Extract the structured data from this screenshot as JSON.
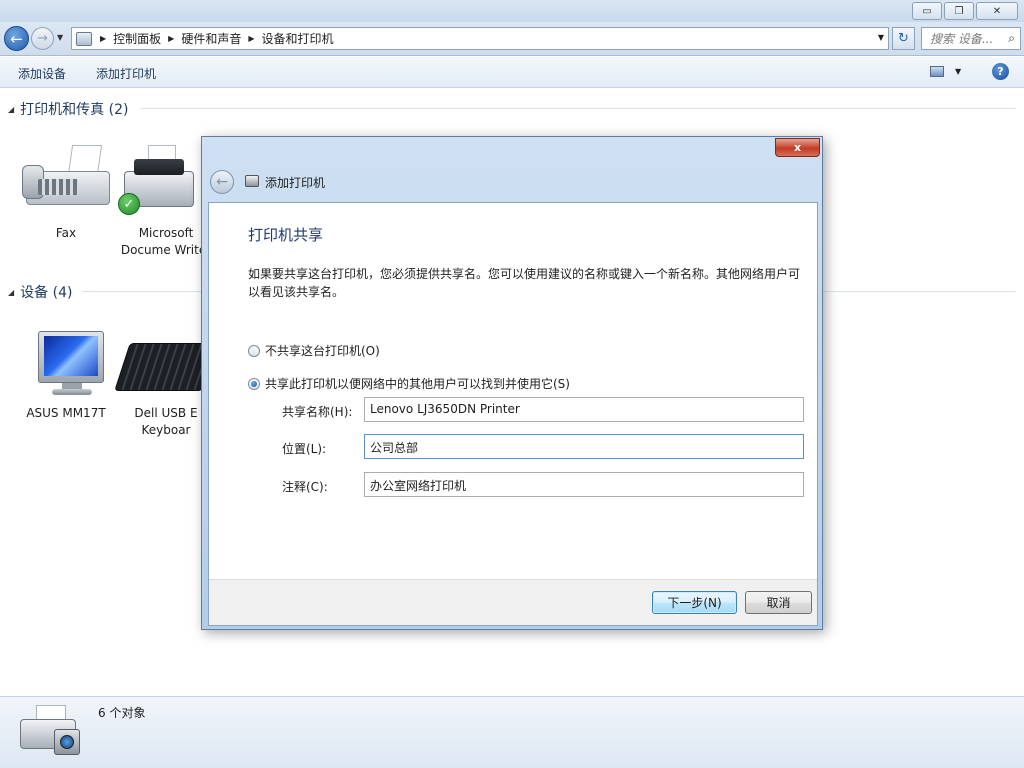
{
  "window": {
    "min_glyph": "▭",
    "max_glyph": "❐",
    "close_glyph": "✕"
  },
  "nav": {
    "back_glyph": "←",
    "fwd_glyph": "→",
    "breadcrumb": [
      "控制面板",
      "硬件和声音",
      "设备和打印机"
    ],
    "search_placeholder": "搜索 设备...",
    "refresh_glyph": "↻",
    "search_glyph": "⌕"
  },
  "toolbar": {
    "add_device": "添加设备",
    "add_printer": "添加打印机",
    "help_glyph": "?"
  },
  "groups": {
    "printers": {
      "title": "打印机和传真 (2)",
      "items": [
        {
          "label": "Fax"
        },
        {
          "label": "Microsoft Docume Writer"
        }
      ]
    },
    "devices": {
      "title": "设备 (4)",
      "items": [
        {
          "label": "ASUS MM17T"
        },
        {
          "label": "Dell USB E Keyboar"
        }
      ]
    }
  },
  "status": {
    "count": "6 个对象"
  },
  "dialog": {
    "window_title": "添加打印机",
    "close_glyph": "x",
    "back_glyph": "←",
    "heading": "打印机共享",
    "description": "如果要共享这台打印机，您必须提供共享名。您可以使用建议的名称或键入一个新名称。其他网络用户可以看见该共享名。",
    "option_no_share": "不共享这台打印机(O)",
    "option_share": "共享此打印机以便网络中的其他用户可以找到并使用它(S)",
    "selected_option": "share",
    "share_name_label": "共享名称(H):",
    "share_name_value": "Lenovo LJ3650DN Printer",
    "location_label": "位置(L):",
    "location_value": "公司总部",
    "comment_label": "注释(C):",
    "comment_value": "办公室网络打印机",
    "next_button": "下一步(N)",
    "cancel_button": "取消"
  },
  "colors": {
    "heading_blue": "#1e3a6e",
    "dialog_frame": "#b3cde8",
    "close_red": "#c23b22"
  }
}
